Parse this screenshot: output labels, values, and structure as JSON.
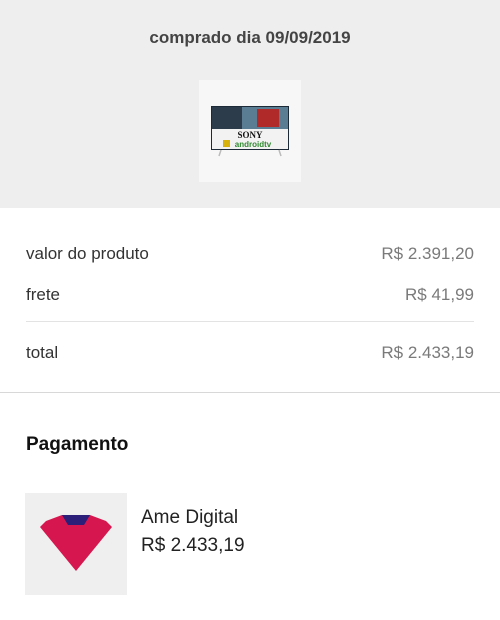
{
  "header": {
    "purchase_date": "comprado dia 09/09/2019",
    "product_image": {
      "icon": "tv-product-image",
      "brand_text": "SONY",
      "platform_text": "androidtv"
    }
  },
  "summary": {
    "rows": [
      {
        "label": "valor do produto",
        "value": "R$ 2.391,20"
      },
      {
        "label": "frete",
        "value": "R$ 41,99"
      },
      {
        "label": "total",
        "value": "R$ 2.433,19"
      }
    ]
  },
  "payment": {
    "title": "Pagamento",
    "method_name": "Ame Digital",
    "amount": "R$ 2.433,19",
    "logo_icon": "ame-heart-icon",
    "logo_color": "#d6174f"
  }
}
